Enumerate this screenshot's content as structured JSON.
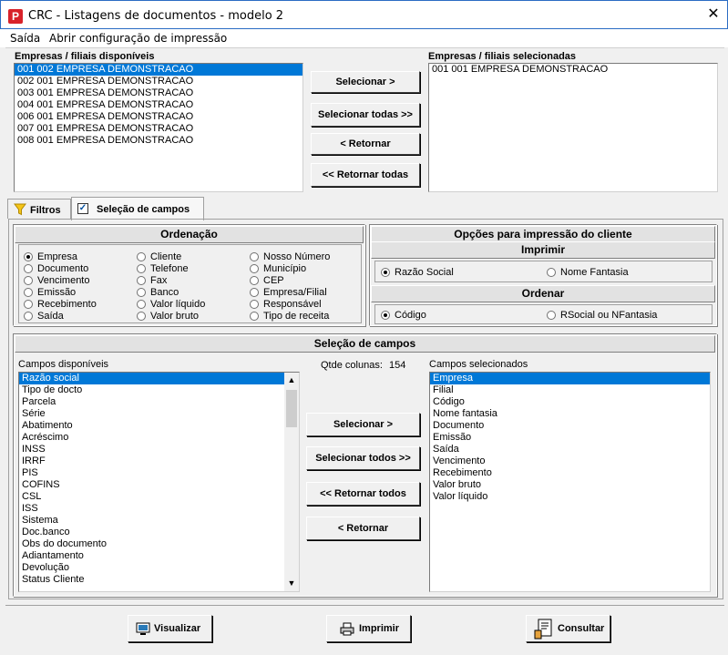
{
  "window": {
    "title": "CRC - Listagens de documentos - modelo 2",
    "close": "✕"
  },
  "menu": {
    "items": [
      "Saída",
      "Abrir configuração de impressão"
    ]
  },
  "empresas": {
    "available_label": "Empresas / filiais disponíveis",
    "selected_label": "Empresas / filiais selecionadas",
    "available": [
      "001 002 EMPRESA DEMONSTRACAO",
      "002 001 EMPRESA DEMONSTRACAO",
      "003 001 EMPRESA DEMONSTRACAO",
      "004 001 EMPRESA DEMONSTRACAO",
      "006 001 EMPRESA DEMONSTRACAO",
      "007 001 EMPRESA DEMONSTRACAO",
      "008 001 EMPRESA DEMONSTRACAO"
    ],
    "selected": [
      "001 001 EMPRESA DEMONSTRACAO"
    ],
    "buttons": [
      "Selecionar >",
      "Selecionar todas >>",
      "< Retornar",
      "<< Retornar todas"
    ]
  },
  "tabs": {
    "filtros": "Filtros",
    "selecao": "Seleção de campos"
  },
  "ordenacao": {
    "title": "Ordenação",
    "col1": [
      "Empresa",
      "Documento",
      "Vencimento",
      "Emissão",
      "Recebimento",
      "Saída"
    ],
    "col2": [
      "Cliente",
      "Telefone",
      "Fax",
      "Banco",
      "Valor líquido",
      "Valor bruto"
    ],
    "col3": [
      "Nosso Número",
      "Município",
      "CEP",
      "Empresa/Filial",
      "Responsável",
      "Tipo de receita"
    ]
  },
  "opcoes": {
    "title": "Opções para impressão do cliente",
    "imprimir_title": "Imprimir",
    "imprimir": [
      "Razão Social",
      "Nome Fantasia"
    ],
    "ordenar_title": "Ordenar",
    "ordenar": [
      "Código",
      "RSocial ou NFantasia"
    ]
  },
  "selecao": {
    "title": "Seleção de campos",
    "available_label": "Campos disponíveis",
    "selected_label": "Campos selecionados",
    "qtde_label": "Qtde colunas:",
    "qtde_value": "154",
    "available": [
      "Razão social",
      "Tipo de docto",
      "Parcela",
      "Série",
      "Abatimento",
      "Acréscimo",
      "INSS",
      "IRRF",
      "PIS",
      "COFINS",
      "CSL",
      "ISS",
      "Sistema",
      "Doc.banco",
      "Obs do documento",
      "Adiantamento",
      "Devolução",
      "Status Cliente"
    ],
    "selected": [
      "Empresa",
      "Filial",
      "Código",
      "Nome fantasia",
      "Documento",
      "Emissão",
      "Saída",
      "Vencimento",
      "Recebimento",
      "Valor bruto",
      "Valor líquido"
    ],
    "buttons": [
      "Selecionar >",
      "Selecionar todos >>",
      "<< Retornar todos",
      "< Retornar"
    ]
  },
  "footer": {
    "buttons": [
      "Visualizar",
      "Imprimir",
      "Consultar"
    ]
  }
}
